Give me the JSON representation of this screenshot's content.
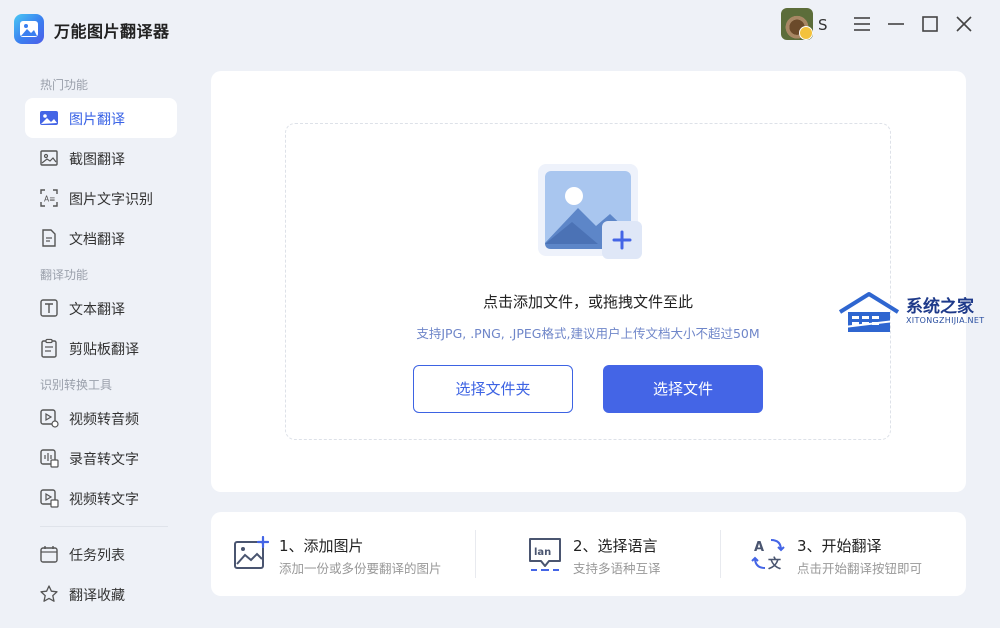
{
  "app": {
    "title": "万能图片翻译器",
    "user_name": "S"
  },
  "sidebar": {
    "sections": [
      {
        "label": "热门功能"
      },
      {
        "label": "翻译功能"
      },
      {
        "label": "识别转换工具"
      }
    ],
    "items": [
      {
        "label": "图片翻译",
        "icon": "image-icon",
        "active": true
      },
      {
        "label": "截图翻译",
        "icon": "screenshot-icon"
      },
      {
        "label": "图片文字识别",
        "icon": "ocr-icon"
      },
      {
        "label": "文档翻译",
        "icon": "document-icon"
      },
      {
        "label": "文本翻译",
        "icon": "text-icon"
      },
      {
        "label": "剪贴板翻译",
        "icon": "clipboard-icon"
      },
      {
        "label": "视频转音频",
        "icon": "video-audio-icon"
      },
      {
        "label": "录音转文字",
        "icon": "record-text-icon"
      },
      {
        "label": "视频转文字",
        "icon": "video-text-icon"
      },
      {
        "label": "任务列表",
        "icon": "calendar-icon"
      },
      {
        "label": "翻译收藏",
        "icon": "star-icon"
      }
    ]
  },
  "upload": {
    "title": "点击添加文件，或拖拽文件至此",
    "hint": "支持JPG, .PNG, .JPEG格式,建议用户上传文档大小不超过50M",
    "folder_button": "选择文件夹",
    "file_button": "选择文件"
  },
  "steps": [
    {
      "title": "1、添加图片",
      "desc": "添加一份或多份要翻译的图片",
      "icon": "add-image-icon"
    },
    {
      "title": "2、选择语言",
      "desc": "支持多语种互译",
      "icon": "language-icon"
    },
    {
      "title": "3、开始翻译",
      "desc": "点击开始翻译按钮即可",
      "icon": "translate-icon"
    }
  ],
  "watermark": {
    "text": "系统之家",
    "sub": "XITONGZHIJIA.NET"
  },
  "colors": {
    "accent": "#4465e6",
    "background": "#eef1f7"
  }
}
